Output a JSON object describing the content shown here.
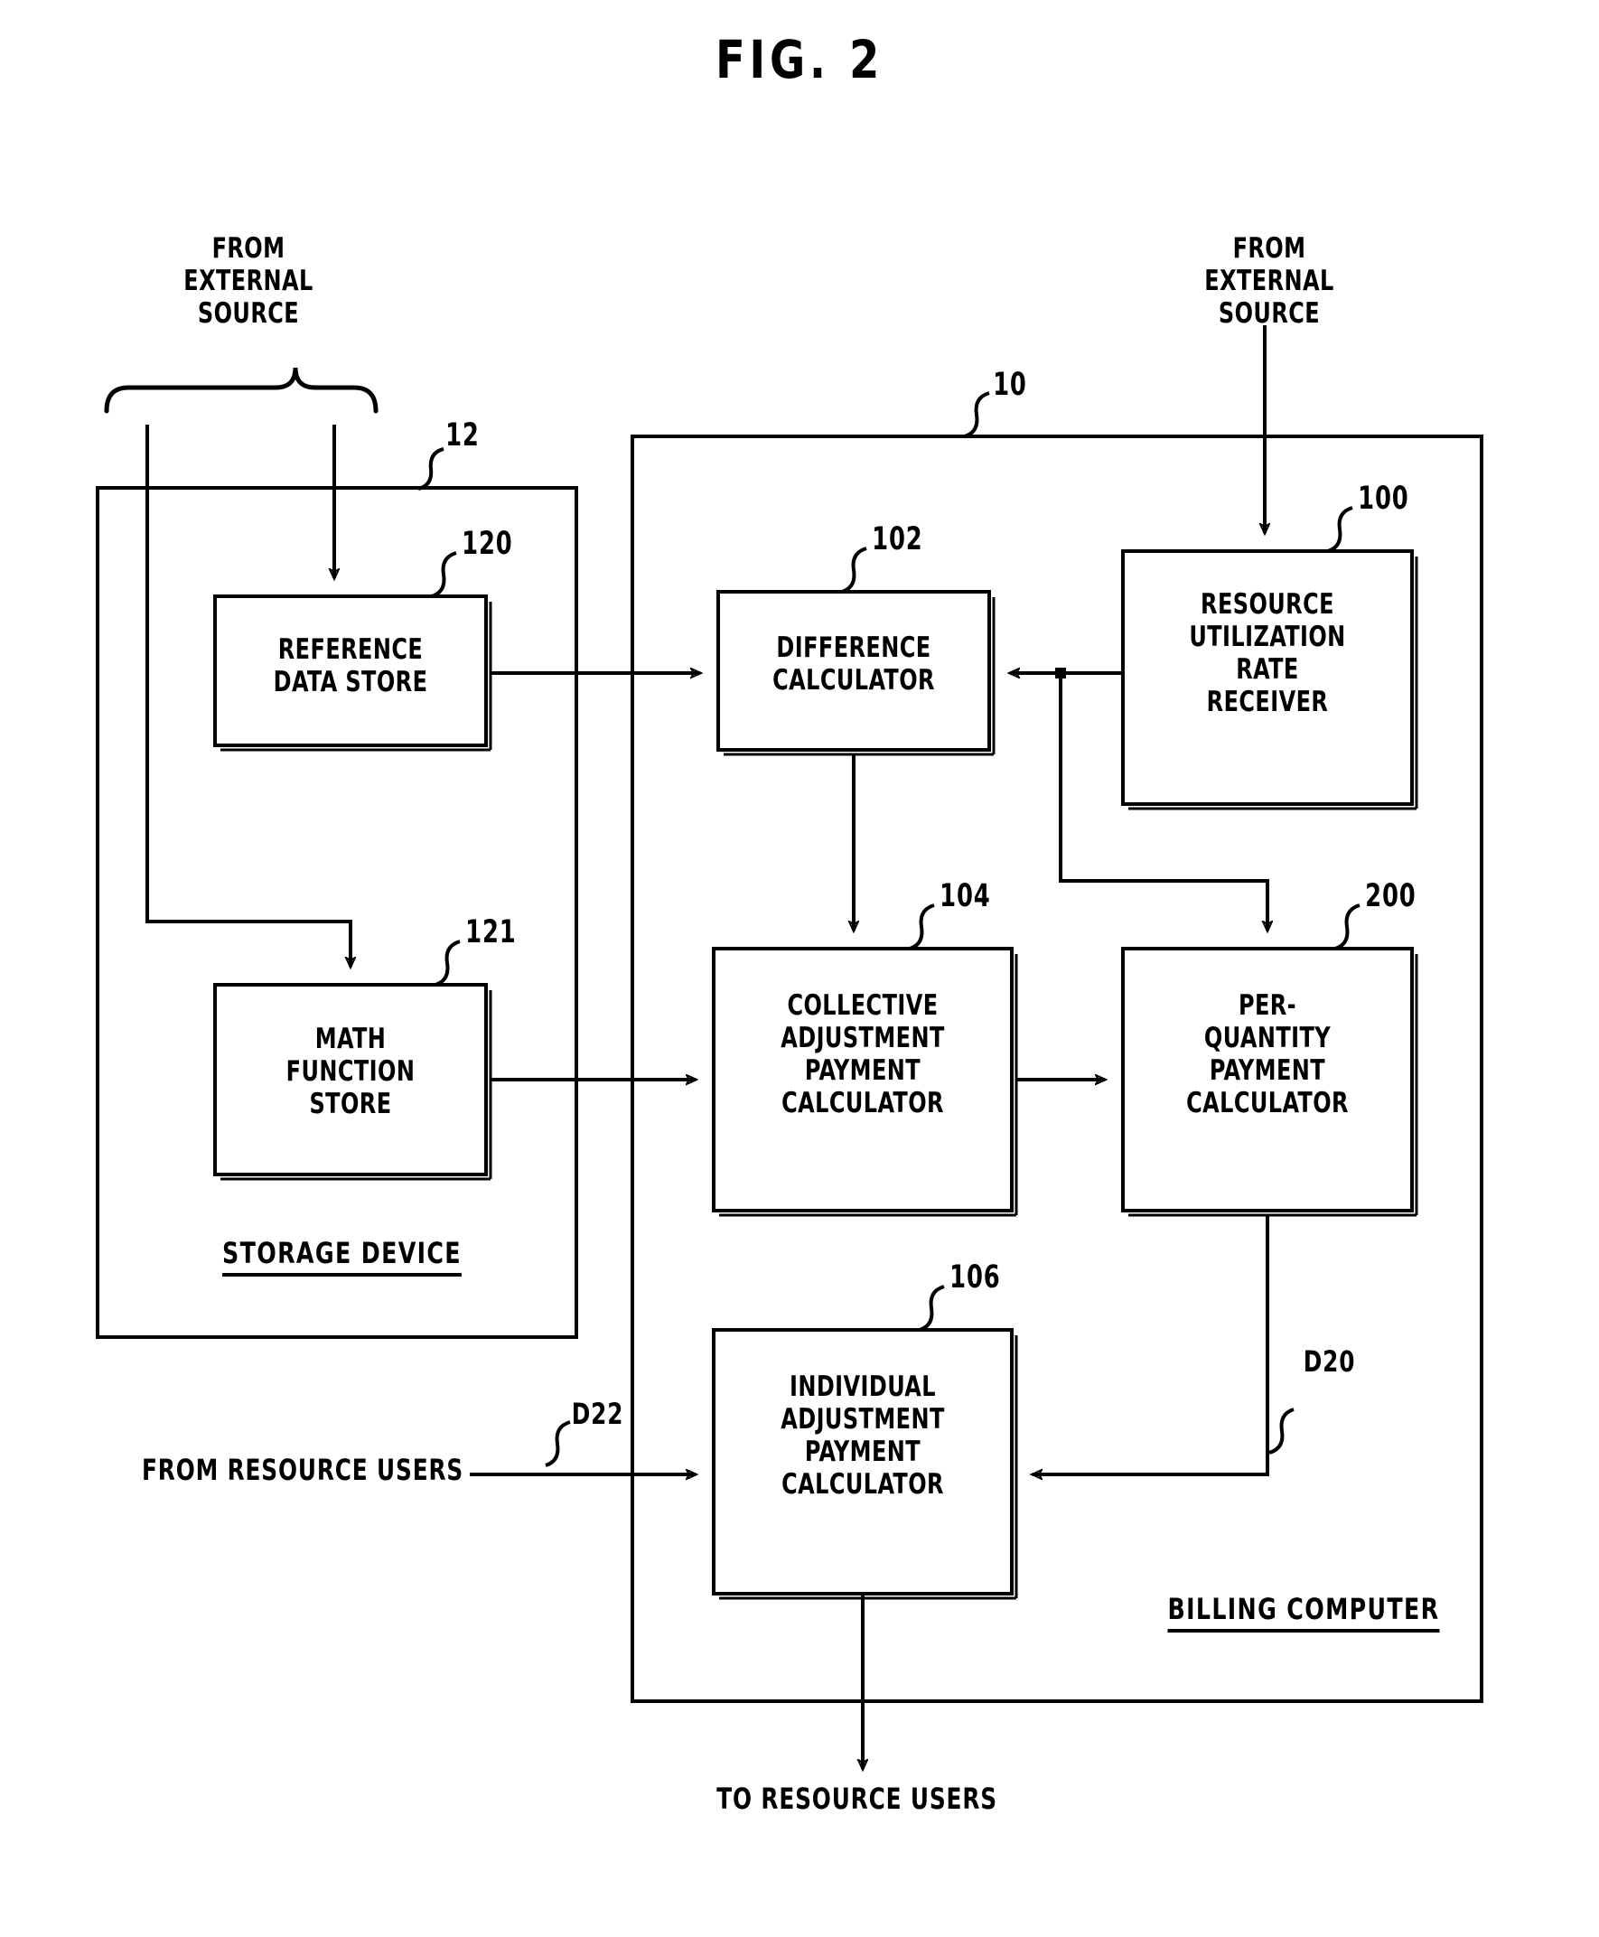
{
  "figure": {
    "title": "FIG. 2"
  },
  "external_sources": {
    "left": "FROM\nEXTERNAL\nSOURCE",
    "right": "FROM\nEXTERNAL\nSOURCE"
  },
  "containers": [
    {
      "id": "storage-device",
      "label": "STORAGE DEVICE",
      "ref": "12"
    },
    {
      "id": "billing-computer",
      "label": "BILLING COMPUTER",
      "ref": "10"
    }
  ],
  "blocks": [
    {
      "id": "reference-data-store",
      "label": "REFERENCE\nDATA STORE",
      "ref": "120"
    },
    {
      "id": "math-function-store",
      "label": "MATH\nFUNCTION\nSTORE",
      "ref": "121"
    },
    {
      "id": "difference-calculator",
      "label": "DIFFERENCE\nCALCULATOR",
      "ref": "102"
    },
    {
      "id": "resource-utilization-rate-receiver",
      "label": "RESOURCE\nUTILIZATION\nRATE\nRECEIVER",
      "ref": "100"
    },
    {
      "id": "collective-adjustment-payment-calculator",
      "label": "COLLECTIVE\nADJUSTMENT\nPAYMENT\nCALCULATOR",
      "ref": "104"
    },
    {
      "id": "per-quantity-payment-calculator",
      "label": "PER-\nQUANTITY\nPAYMENT\nCALCULATOR",
      "ref": "200"
    },
    {
      "id": "individual-adjustment-payment-calculator",
      "label": "INDIVIDUAL\nADJUSTMENT\nPAYMENT\nCALCULATOR",
      "ref": "106"
    }
  ],
  "signals": {
    "d20": "D20",
    "d22": "D22"
  },
  "io_labels": {
    "from_resource_users": "FROM RESOURCE USERS",
    "to_resource_users": "TO RESOURCE USERS"
  },
  "colors": {
    "stroke": "#000000",
    "background": "#ffffff"
  }
}
